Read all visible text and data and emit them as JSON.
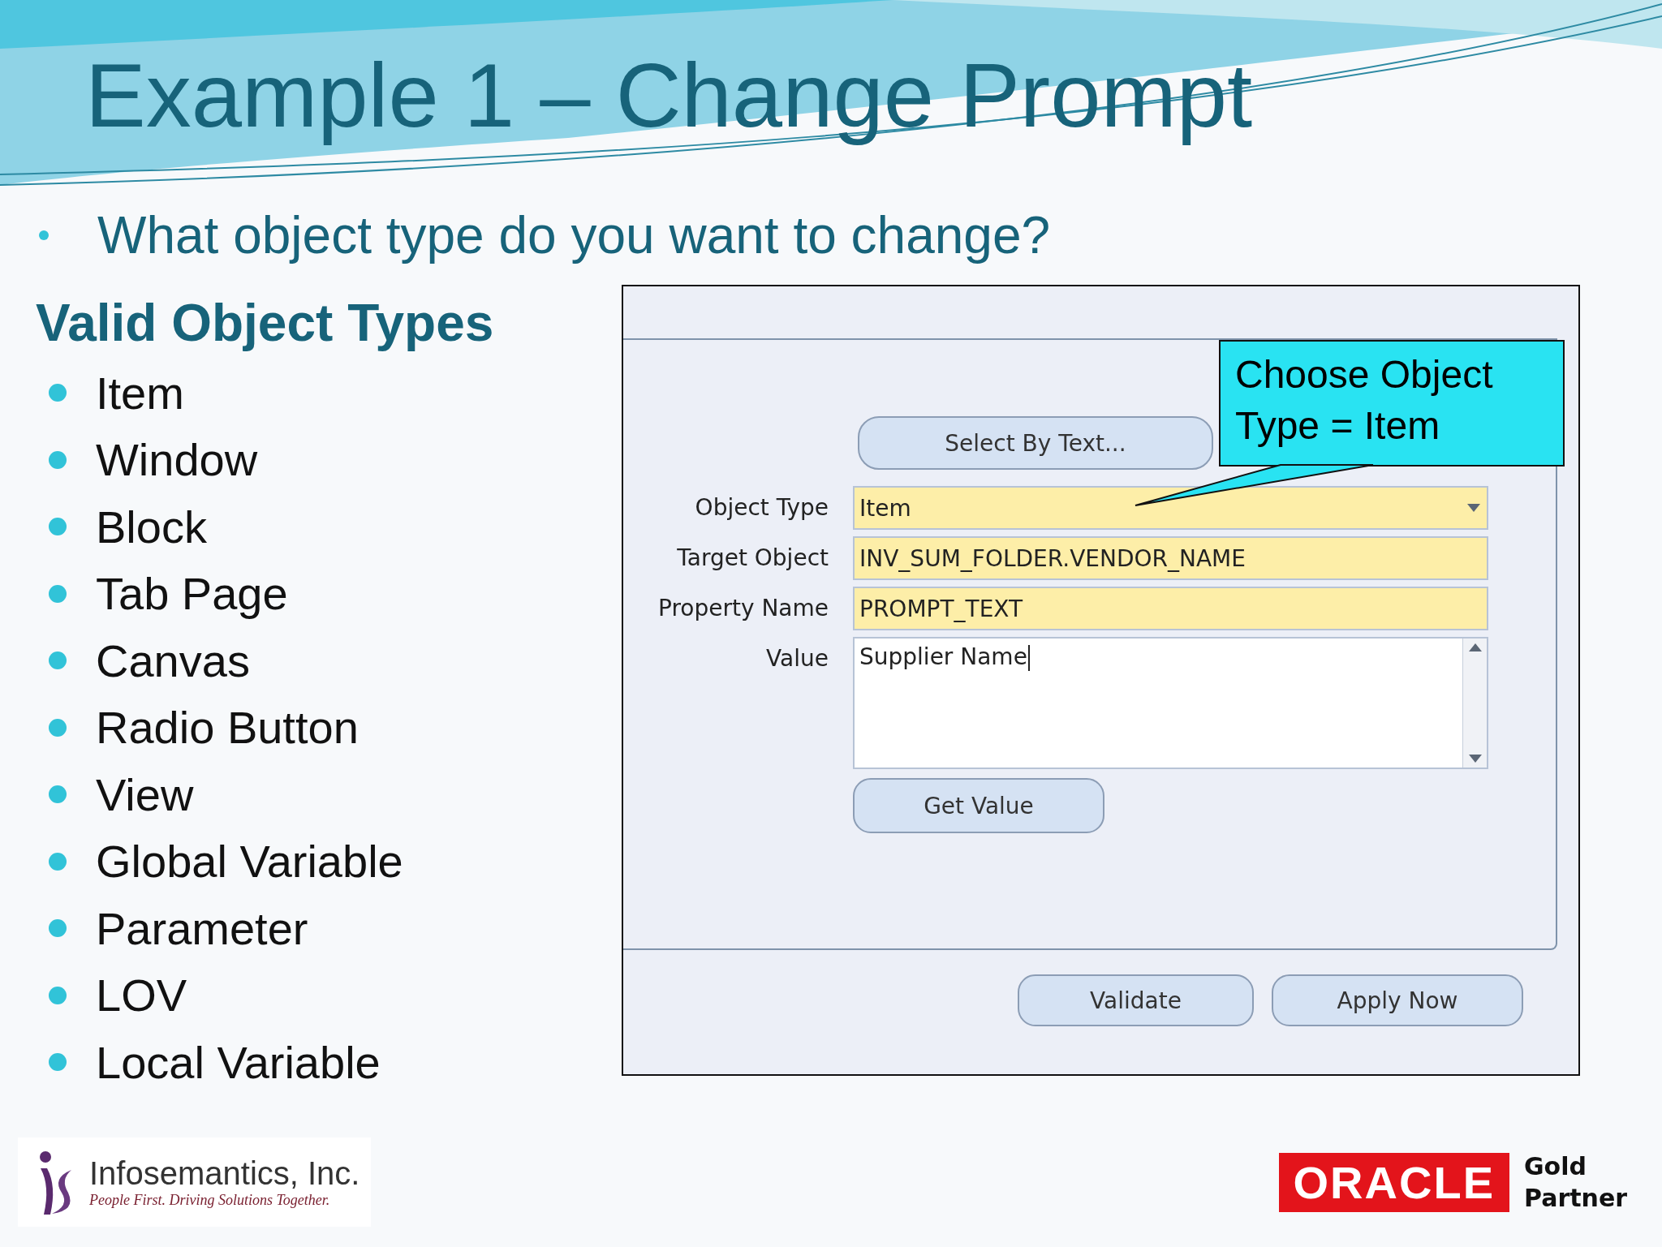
{
  "title": "Example 1 – Change Prompt",
  "question": "What object type do you want to change?",
  "list_heading": "Valid Object Types",
  "object_types": [
    "Item",
    "Window",
    "Block",
    "Tab Page",
    "Canvas",
    "Radio Button",
    "View",
    "Global Variable",
    "Parameter",
    "LOV",
    "Local Variable"
  ],
  "dialog": {
    "select_button": "Select By Text...",
    "fields": [
      {
        "label": "Object Type",
        "value": "Item",
        "kind": "dropdown"
      },
      {
        "label": "Target Object",
        "value": "INV_SUM_FOLDER.VENDOR_NAME",
        "kind": "text"
      },
      {
        "label": "Property Name",
        "value": "PROMPT_TEXT",
        "kind": "text"
      },
      {
        "label": "Value",
        "value": "Supplier Name",
        "kind": "textarea"
      }
    ],
    "get_value_button": "Get Value",
    "buttons": [
      "Validate",
      "Apply Now"
    ]
  },
  "callout": "Choose Object Type = Item",
  "footer": {
    "company": "Infosemantics, Inc.",
    "tagline": "People First. Driving Solutions Together.",
    "partner_logo": "ORACLE",
    "partner_level": "Gold Partner"
  }
}
